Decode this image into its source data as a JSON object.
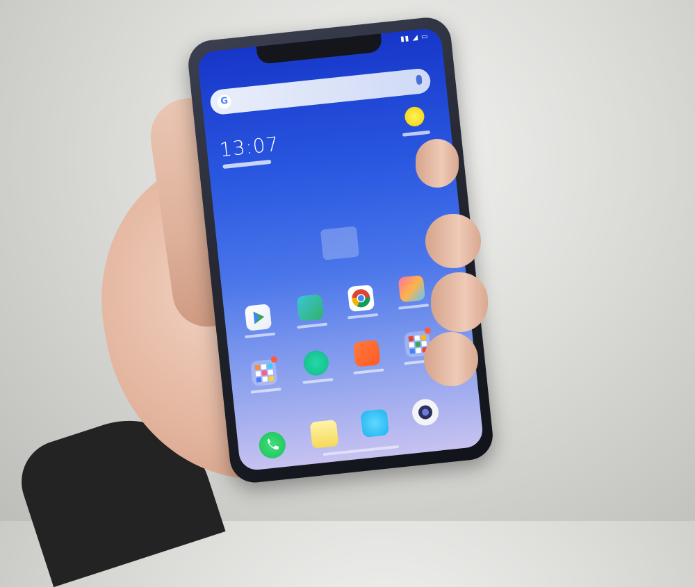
{
  "screen": {
    "time": "13:07"
  },
  "colors": {
    "wallpaper_top": "#1736c9",
    "wallpaper_bottom": "#c7c2f0",
    "phone_frame": "#1e2029",
    "skin": "#e2b39c"
  },
  "icons": {
    "search": "google-g-icon",
    "mic": "mic-icon",
    "weather": "sun-icon"
  }
}
